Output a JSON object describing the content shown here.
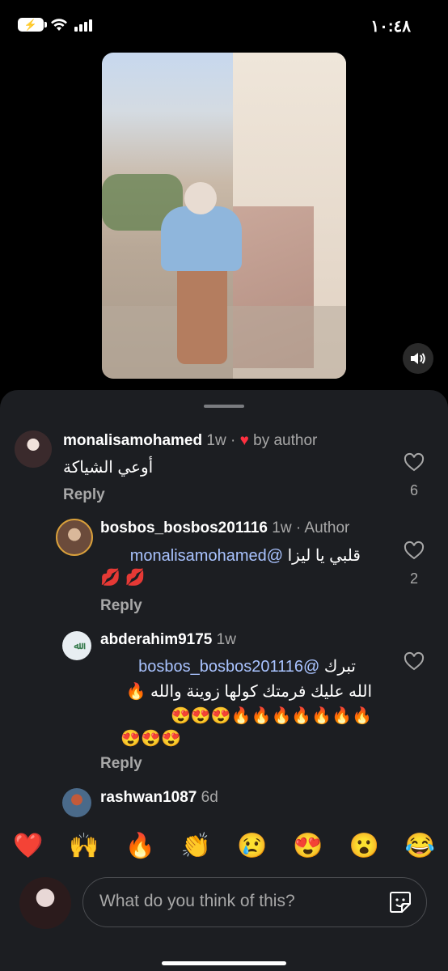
{
  "status_bar": {
    "time": "١٠:٤٨"
  },
  "media": {
    "sound_icon": "speaker-icon"
  },
  "comments": [
    {
      "username": "monalisamohamed",
      "time": "1w",
      "badge": "by author",
      "text": "أوعي الشياكة",
      "reply": "Reply",
      "likes": "6"
    },
    {
      "username": "bosbos_bosbos201116",
      "time": "1w · Author",
      "mention": "@monalisamohamed",
      "text": "قلبي يا ليزا",
      "emojis": "💋 💋",
      "reply": "Reply",
      "likes": "2"
    },
    {
      "username": "abderahim9175",
      "time": "1w",
      "mention": "@bosbos_bosbos201116",
      "text_start": "تبرك",
      "text_line2": "الله عليك فرمتك كولها زوينة والله 🔥",
      "text_line3": "🔥🔥🔥🔥🔥🔥🔥😍😍😍",
      "text_line4": "😍😍😍",
      "reply": "Reply"
    },
    {
      "username": "rashwan1087",
      "time": "6d"
    }
  ],
  "reactions": [
    "❤️",
    "🙌",
    "🔥",
    "👏",
    "😢",
    "😍",
    "😮",
    "😂"
  ],
  "composer": {
    "placeholder": "What do you think of this?"
  },
  "colors": {
    "sheet": "#1c1e22",
    "mention": "#a9c3ff",
    "heart": "#ff3040"
  }
}
